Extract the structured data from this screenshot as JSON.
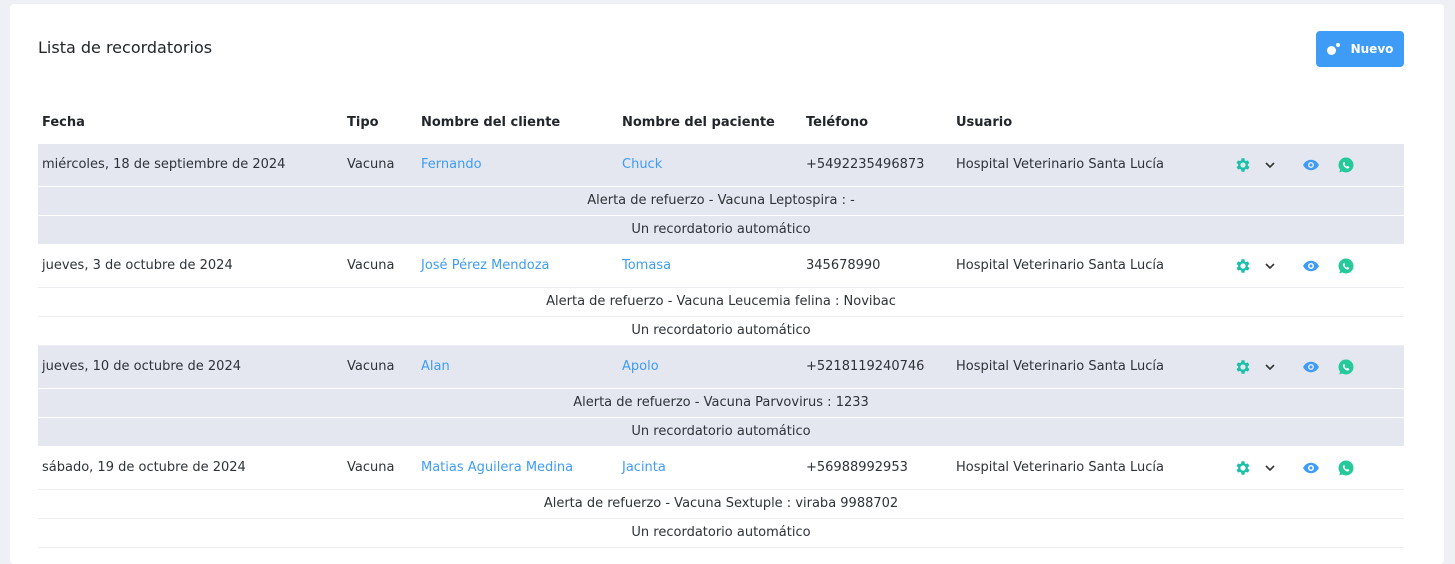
{
  "page": {
    "title": "Lista de recordatorios"
  },
  "toolbar": {
    "new_label": "Nuevo"
  },
  "table": {
    "headers": {
      "fecha": "Fecha",
      "tipo": "Tipo",
      "cliente": "Nombre del cliente",
      "paciente": "Nombre del paciente",
      "telefono": "Teléfono",
      "usuario": "Usuario"
    },
    "rows": [
      {
        "fecha": "miércoles, 18 de septiembre de 2024",
        "tipo": "Vacuna",
        "cliente": "Fernando",
        "paciente": "Chuck",
        "telefono": "+5492235496873",
        "usuario": "Hospital Veterinario Santa Lucía",
        "alerta": "Alerta de refuerzo - Vacuna Leptospira : -",
        "nota": "Un recordatorio automático"
      },
      {
        "fecha": "jueves, 3 de octubre de 2024",
        "tipo": "Vacuna",
        "cliente": "José Pérez Mendoza",
        "paciente": "Tomasa",
        "telefono": "345678990",
        "usuario": "Hospital Veterinario Santa Lucía",
        "alerta": "Alerta de refuerzo - Vacuna Leucemia felina : Novibac",
        "nota": "Un recordatorio automático"
      },
      {
        "fecha": "jueves, 10 de octubre de 2024",
        "tipo": "Vacuna",
        "cliente": "Alan",
        "paciente": "Apolo",
        "telefono": "+5218119240746",
        "usuario": "Hospital Veterinario Santa Lucía",
        "alerta": "Alerta de refuerzo - Vacuna Parvovirus : 1233",
        "nota": "Un recordatorio automático"
      },
      {
        "fecha": "sábado, 19 de octubre de 2024",
        "tipo": "Vacuna",
        "cliente": "Matias Aguilera Medina",
        "paciente": "Jacinta",
        "telefono": "+56988992953",
        "usuario": "Hospital Veterinario Santa Lucía",
        "alerta": "Alerta de refuerzo - Vacuna Sextuple : viraba 9988702",
        "nota": "Un recordatorio automático"
      }
    ]
  },
  "icons": {
    "settings": "gear-icon",
    "dropdown": "chevron-down-icon",
    "view": "eye-icon",
    "whatsapp": "whatsapp-icon"
  },
  "colors": {
    "accent": "#3e9cf7",
    "gear": "#1cbfa7",
    "whatsapp": "#25c99a",
    "shaded_row": "#e4e7f0"
  }
}
